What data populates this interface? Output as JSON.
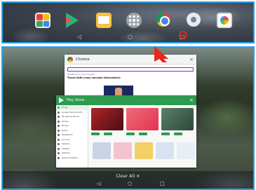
{
  "top": {
    "dock_apps": [
      "folder-icon",
      "play-store-icon",
      "mail-icon",
      "app-drawer-icon",
      "chrome-icon",
      "settings-icon",
      "photos-icon"
    ],
    "nav": {
      "back": "◁",
      "home": "○",
      "recents": "□"
    }
  },
  "recents": {
    "chrome_card": {
      "title": "Chrome",
      "close": "×",
      "line1": "Whats hot in your country",
      "line2": "Travel with crazy concept (decorative)"
    },
    "play_card": {
      "title": "Play Store",
      "close": "×",
      "sidebar": [
        "Home",
        "Google Play Products",
        "My apps & games",
        "Library",
        "Movies",
        "Books",
        "Newsstand",
        "Account",
        "Redeem",
        "Wishlist",
        "Settings",
        "Help & feedback"
      ]
    },
    "clear_all": "Clear All ✕",
    "nav": {
      "back": "◁",
      "home": "○",
      "recents": "□"
    }
  },
  "colors": {
    "accent": "#2ba3e6",
    "annotation": "#e8261e",
    "play_green": "#2e9a4f"
  }
}
